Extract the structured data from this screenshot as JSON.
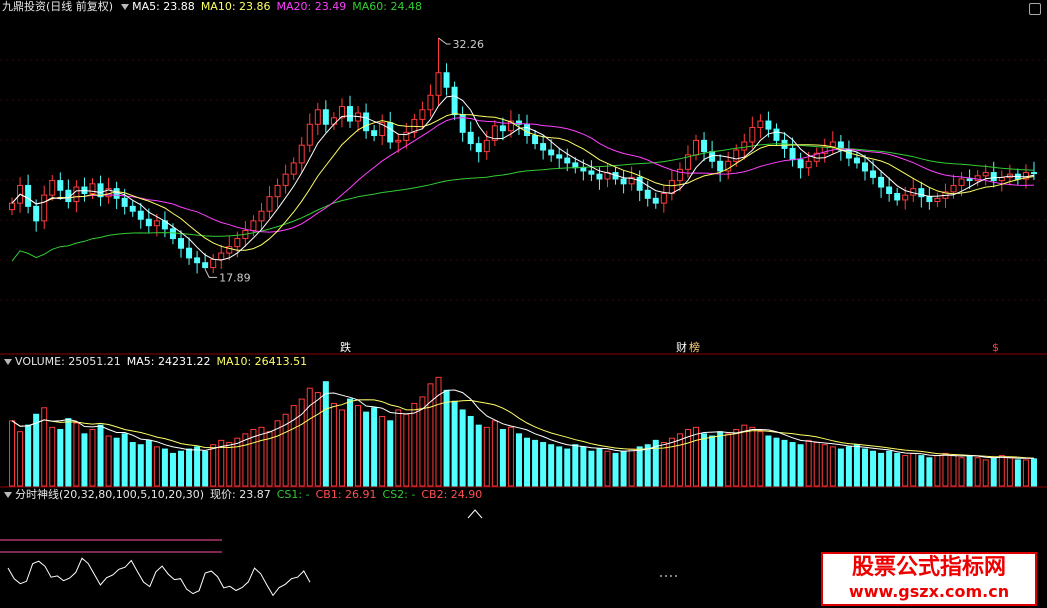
{
  "main": {
    "title": "九鼎投资(日线 前复权)",
    "ma5_label": "MA5: 23.88",
    "ma10_label": "MA10: 23.86",
    "ma20_label": "MA20: 23.49",
    "ma60_label": "MA60: 24.48",
    "high_label": "32.26",
    "low_label": "17.89",
    "event_labels": [
      "跌",
      "财",
      "榜",
      "$"
    ]
  },
  "volume": {
    "label": "VOLUME: 25051.21",
    "ma5_label": "MA5: 24231.22",
    "ma10_label": "MA10: 26413.51"
  },
  "indicator": {
    "name": "分时神线(20,32,80,100,5,10,20,30)",
    "price_label": "现价: 23.87",
    "cs1": "CS1: -",
    "cb1": "CB1: 26.91",
    "cs2": "CS2: -",
    "cb2": "CB2: 24.90"
  },
  "watermark": {
    "line1": "股票公式指标网",
    "line2": "www.gszx.com.cn"
  },
  "colors": {
    "up": "#ff3b3b",
    "down": "#54ffff",
    "ma5": "#ffffff",
    "ma10": "#ffff66",
    "ma20": "#ff40ff",
    "ma60": "#33cc33",
    "grid": "#8b0000"
  },
  "chart_data": {
    "type": "candlestick",
    "high_marker": 32.26,
    "low_marker": 17.89,
    "last_close": 23.87,
    "closes": [
      22.0,
      23.1,
      21.8,
      20.9,
      22.5,
      23.4,
      22.8,
      22.1,
      23.0,
      22.6,
      23.2,
      22.4,
      22.9,
      22.3,
      21.8,
      21.5,
      21.0,
      20.6,
      20.9,
      20.4,
      19.8,
      19.2,
      18.6,
      18.3,
      18.0,
      18.5,
      18.9,
      19.3,
      19.8,
      20.3,
      20.9,
      21.5,
      22.4,
      23.1,
      23.8,
      24.5,
      25.6,
      26.9,
      27.8,
      26.9,
      27.3,
      28.0,
      27.1,
      27.6,
      26.5,
      26.2,
      27.0,
      25.8,
      25.9,
      26.4,
      27.2,
      27.8,
      28.7,
      30.1,
      29.2,
      27.5,
      26.4,
      25.7,
      25.2,
      25.9,
      26.8,
      26.5,
      27.1,
      26.9,
      26.2,
      25.7,
      25.3,
      25.0,
      24.8,
      24.5,
      24.2,
      24.0,
      23.8,
      23.5,
      23.9,
      23.5,
      23.2,
      23.6,
      22.8,
      22.3,
      22.0,
      22.6,
      23.4,
      24.1,
      25.0,
      25.9,
      25.2,
      24.6,
      24.0,
      24.6,
      25.3,
      25.8,
      26.7,
      27.1,
      26.6,
      25.9,
      25.4,
      24.7,
      24.2,
      24.6,
      25.1,
      25.5,
      25.8,
      25.3,
      24.8,
      24.5,
      24.0,
      23.6,
      23.0,
      22.6,
      22.2,
      22.5,
      22.9,
      22.4,
      22.1,
      22.3,
      22.7,
      23.1,
      23.5,
      23.4,
      23.7,
      23.9,
      23.4,
      23.6,
      23.8,
      23.5,
      23.9,
      23.87
    ],
    "volume_last": 25051.21,
    "volume_ma5": 24231.22,
    "volume_ma10": 26413.51,
    "volumes": [
      30000,
      25000,
      28000,
      33000,
      36000,
      27000,
      26000,
      31000,
      29000,
      24000,
      26000,
      28000,
      23000,
      22000,
      24000,
      20000,
      19000,
      21000,
      18000,
      17000,
      15000,
      16000,
      17000,
      18000,
      16000,
      19000,
      21000,
      20000,
      22000,
      24000,
      26000,
      27000,
      25000,
      30000,
      33000,
      37000,
      40000,
      45000,
      43000,
      48000,
      38000,
      35000,
      40000,
      37000,
      34000,
      36000,
      32000,
      30000,
      35000,
      33000,
      38000,
      41000,
      47000,
      50000,
      44000,
      39000,
      35000,
      32000,
      28000,
      27000,
      30000,
      26000,
      27000,
      24000,
      22000,
      21000,
      20000,
      19000,
      18000,
      17000,
      19000,
      18000,
      16000,
      17000,
      16000,
      15000,
      16000,
      17000,
      18000,
      19000,
      21000,
      20000,
      22000,
      24000,
      26000,
      27000,
      24000,
      23000,
      25000,
      24000,
      26000,
      28000,
      27000,
      25000,
      23000,
      22000,
      21000,
      20000,
      19000,
      21000,
      20000,
      19000,
      18000,
      17000,
      18000,
      19000,
      17000,
      16000,
      15000,
      16000,
      15000,
      14000,
      15000,
      14000,
      13000,
      14000,
      15000,
      14000,
      13000,
      14000,
      13000,
      12000,
      13000,
      14000,
      13000,
      12000,
      12000,
      12500
    ]
  }
}
